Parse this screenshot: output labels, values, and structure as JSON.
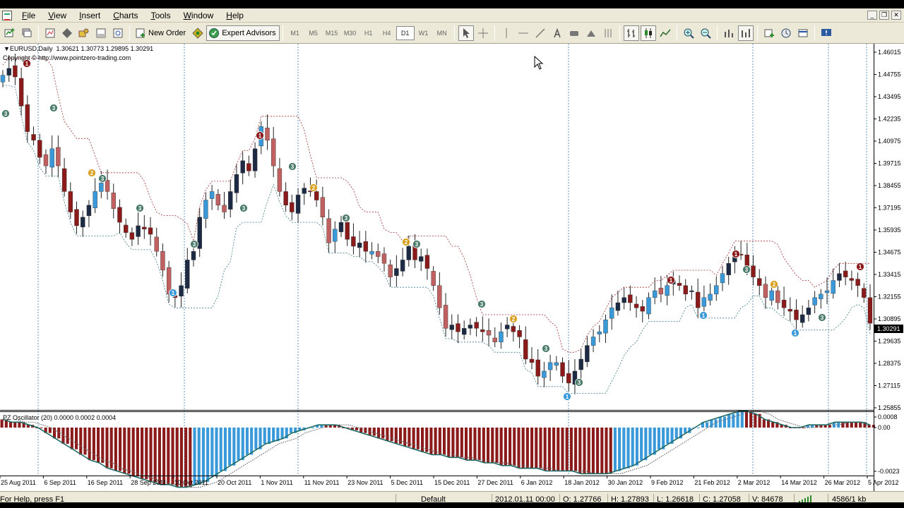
{
  "menu": [
    "File",
    "View",
    "Insert",
    "Charts",
    "Tools",
    "Window",
    "Help"
  ],
  "toolbar": {
    "new_order": "New Order",
    "expert_advisors": "Expert Advisors",
    "timeframes": [
      "M1",
      "M5",
      "M15",
      "M30",
      "H1",
      "H4",
      "D1",
      "W1",
      "MN"
    ],
    "active_timeframe": "D1"
  },
  "chart": {
    "header": "EURUSD,Daily  1.30621 1.30773 1.29895 1.30291",
    "copyright": "Copyright © http://www.pointzero-trading.com",
    "current_price": "1.30291",
    "oscillator_header": "PZ Oscillator (20) 0.0000 0.0002 0.0004",
    "price_axis": [
      "1.46015",
      "1.44755",
      "1.43495",
      "1.42235",
      "1.40975",
      "1.39715",
      "1.38455",
      "1.37195",
      "1.35935",
      "1.34675",
      "1.33415",
      "1.32155",
      "1.30895",
      "1.29635",
      "1.28375",
      "1.27115",
      "1.25855"
    ],
    "osc_axis": [
      "0.0008",
      "0.00",
      "-0.0023"
    ],
    "date_labels": [
      "25 Aug 2011",
      "6 Sep 2011",
      "16 Sep 2011",
      "28 Sep 2011",
      "10 Oct 2011",
      "20 Oct 2011",
      "1 Nov 2011",
      "11 Nov 2011",
      "23 Nov 2011",
      "5 Dec 2011",
      "15 Dec 2011",
      "27 Dec 2011",
      "6 Jan 2012",
      "18 Jan 2012",
      "30 Jan 2012",
      "9 Feb 2012",
      "21 Feb 2012",
      "2 Mar 2012",
      "14 Mar 2012",
      "26 Mar 2012",
      "5 Apr 2012"
    ],
    "colors": {
      "bull": "#3a9ad9",
      "bear": "#8b1a1a",
      "bear_light": "#c06060",
      "dark": "#1c2a44",
      "signal_green": "#4a7a6a",
      "signal_orange": "#d9a020"
    }
  },
  "chart_data": {
    "type": "candlestick",
    "symbol": "EURUSD",
    "timeframe": "Daily",
    "ylim": [
      1.2523,
      1.4664
    ],
    "closes": [
      1.448,
      1.452,
      1.447,
      1.43,
      1.415,
      1.41,
      1.4,
      1.395,
      1.405,
      1.395,
      1.38,
      1.368,
      1.36,
      1.365,
      1.372,
      1.38,
      1.385,
      1.38,
      1.37,
      1.362,
      1.356,
      1.352,
      1.36,
      1.358,
      1.355,
      1.345,
      1.334,
      1.32,
      1.318,
      1.325,
      1.34,
      1.345,
      1.365,
      1.375,
      1.38,
      1.372,
      1.368,
      1.38,
      1.39,
      1.398,
      1.392,
      1.405,
      1.418,
      1.41,
      1.395,
      1.38,
      1.372,
      1.368,
      1.378,
      1.382,
      1.38,
      1.375,
      1.365,
      1.35,
      1.358,
      1.362,
      1.352,
      1.348,
      1.35,
      1.345,
      1.345,
      1.342,
      1.338,
      1.33,
      1.335,
      1.34,
      1.348,
      1.34,
      1.342,
      1.335,
      1.325,
      1.312,
      1.3,
      1.302,
      1.298,
      1.3,
      1.302,
      1.3,
      1.298,
      1.296,
      1.292,
      1.298,
      1.302,
      1.298,
      1.295,
      1.282,
      1.28,
      1.272,
      1.275,
      1.28,
      1.28,
      1.272,
      1.268,
      1.275,
      1.282,
      1.29,
      1.295,
      1.298,
      1.305,
      1.312,
      1.315,
      1.318,
      1.315,
      1.312,
      1.31,
      1.318,
      1.322,
      1.32,
      1.325,
      1.328,
      1.325,
      1.32,
      1.322,
      1.312,
      1.318,
      1.32,
      1.325,
      1.332,
      1.338,
      1.345,
      1.343,
      1.335,
      1.33,
      1.325,
      1.318,
      1.322,
      1.315,
      1.312,
      1.31,
      1.305,
      1.308,
      1.312,
      1.318,
      1.32,
      1.322,
      1.328,
      1.332,
      1.33,
      1.328,
      1.325,
      1.318,
      1.303
    ],
    "osc": {
      "series": [
        {
          "name": "histogram",
          "values": [
            0.0003,
            0.0002,
            0.0002,
            0.0001,
            0.0,
            -0.0002,
            -0.0004,
            -0.0006,
            -0.0008,
            -0.001,
            -0.0012,
            -0.0013,
            -0.0015,
            -0.0016,
            -0.0017,
            -0.0018,
            -0.0019,
            -0.002,
            -0.0021,
            -0.0021,
            -0.0022,
            -0.0022,
            -0.0021,
            -0.002,
            -0.0018,
            -0.0016,
            -0.0014,
            -0.0012,
            -0.001,
            -0.0008,
            -0.0006,
            -0.0005,
            -0.0004,
            -0.0002,
            -0.0001,
            0.0,
            0.0001,
            0.0001,
            0.0001,
            0.0,
            -0.0001,
            -0.0002,
            -0.0003,
            -0.0004,
            -0.0005,
            -0.0006,
            -0.0007,
            -0.0008,
            -0.0009,
            -0.001,
            -0.001,
            -0.0011,
            -0.0011,
            -0.0012,
            -0.0012,
            -0.0013,
            -0.0013,
            -0.0014,
            -0.0014,
            -0.0015,
            -0.0015,
            -0.0015,
            -0.0016,
            -0.0016,
            -0.0016,
            -0.0016,
            -0.0017,
            -0.0017,
            -0.0017,
            -0.0017,
            -0.0016,
            -0.0015,
            -0.0014,
            -0.0012,
            -0.001,
            -0.0008,
            -0.0006,
            -0.0004,
            -0.0002,
            0.0,
            0.0002,
            0.0003,
            0.0004,
            0.0005,
            0.0006,
            0.0006,
            0.0005,
            0.0003,
            0.0002,
            0.0001,
            0.0,
            0.0,
            0.0001,
            0.0001,
            0.0001,
            0.0002,
            0.0002,
            0.0002,
            0.0002,
            0.0001
          ]
        }
      ]
    }
  },
  "status": {
    "help": "For Help, press F1",
    "profile": "Default",
    "datetime": "2012.01.11 00:00",
    "open": "O: 1.27766",
    "high": "H: 1.27893",
    "low": "L: 1.26618",
    "close": "C: 1.27058",
    "volume": "V: 84678",
    "traffic": "4586/1 kb"
  }
}
